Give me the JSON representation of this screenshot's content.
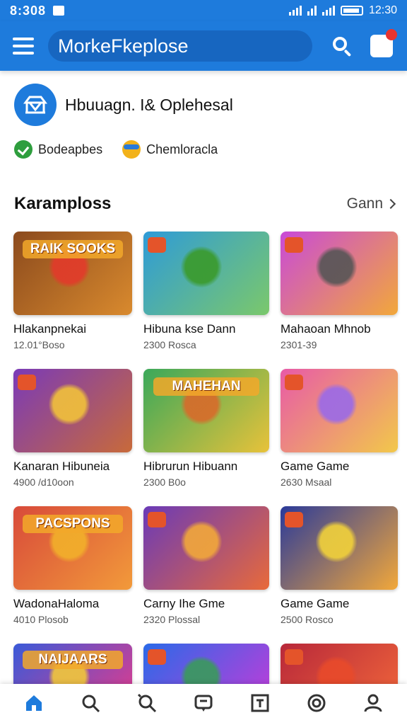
{
  "status": {
    "time": "8:308",
    "clock": "12:30"
  },
  "app_bar": {
    "search_text": "MorkeFkeplose"
  },
  "profile": {
    "name": "Hbuuagn. I& Oplehesal"
  },
  "tags": [
    {
      "label": "Bodeapbes",
      "icon": "check-badge-icon"
    },
    {
      "label": "Chemloracla",
      "icon": "bowl-icon"
    }
  ],
  "section": {
    "title": "Karamploss",
    "see_all": "Gann"
  },
  "games": [
    {
      "title": "Hlakanpnekai",
      "meta": "12.01°Boso",
      "banner": "RAIK SOOKS",
      "colors": [
        "#8b4a1d",
        "#d98a2e"
      ],
      "glow": "#e23a2a"
    },
    {
      "title": "Hibuna kse Dann",
      "meta": "2300 Rosca",
      "banner": "",
      "colors": [
        "#2e9bd8",
        "#7bc86b"
      ],
      "glow": "#3a9a2a"
    },
    {
      "title": "Mahaoan Mhnob",
      "meta": "2301-39",
      "banner": "",
      "colors": [
        "#c94ad8",
        "#f2a83a"
      ],
      "glow": "#555555"
    },
    {
      "title": "Kanaran Hibuneia",
      "meta": "4900 /d10oon",
      "banner": "",
      "colors": [
        "#7a3ab8",
        "#c86a3a"
      ],
      "glow": "#f2c23a"
    },
    {
      "title": "Hibrurun Hibuann",
      "meta": "2300 B0o",
      "banner": "MAHEHAN",
      "colors": [
        "#3aa85a",
        "#e8c23a"
      ],
      "glow": "#d86a2a"
    },
    {
      "title": "Game Game",
      "meta": "2630 Msaal",
      "banner": "",
      "colors": [
        "#e85aa8",
        "#f2c84a"
      ],
      "glow": "#9a6ae8"
    },
    {
      "title": "WadonaHaloma",
      "meta": "4010 Plosob",
      "banner": "PACSPONS",
      "colors": [
        "#d84a3a",
        "#f29a3a"
      ],
      "glow": "#f2b02a"
    },
    {
      "title": "Carny Ihe Gme",
      "meta": "2320 Plossal",
      "banner": "",
      "colors": [
        "#6a3ab8",
        "#e86a3a"
      ],
      "glow": "#f2a83a"
    },
    {
      "title": "Game Game",
      "meta": "2500 Rosco",
      "banner": "",
      "colors": [
        "#2a3a9a",
        "#f2a83a"
      ],
      "glow": "#f2d23a"
    },
    {
      "title": "",
      "meta": "",
      "banner": "NAIJAARS",
      "colors": [
        "#3a5ad8",
        "#e83a8a"
      ],
      "glow": "#f2c83a"
    },
    {
      "title": "",
      "meta": "",
      "banner": "",
      "colors": [
        "#2a6ae8",
        "#c83ad8"
      ],
      "glow": "#3a9a5a"
    },
    {
      "title": "",
      "meta": "",
      "banner": "",
      "colors": [
        "#b8283a",
        "#f2683a"
      ],
      "glow": "#e84a2a"
    }
  ],
  "bottom_nav": [
    {
      "name": "home",
      "icon": "home-icon",
      "active": true
    },
    {
      "name": "search",
      "icon": "search-icon",
      "active": false
    },
    {
      "name": "discover",
      "icon": "magnify-icon",
      "active": false
    },
    {
      "name": "messages",
      "icon": "chat-icon",
      "active": false
    },
    {
      "name": "library",
      "icon": "library-icon",
      "active": false
    },
    {
      "name": "activity",
      "icon": "spiral-icon",
      "active": false
    },
    {
      "name": "profile",
      "icon": "person-icon",
      "active": false
    }
  ],
  "colors": {
    "primary": "#1e7bdc",
    "primary_dark": "#1766c0",
    "active_nav": "#1e7bdc",
    "inactive_nav": "#333333"
  }
}
